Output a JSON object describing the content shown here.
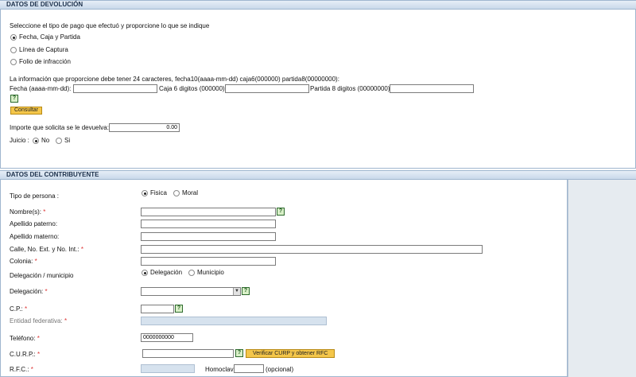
{
  "devolucion": {
    "header": "DATOS DE DEVOLUCIÓN",
    "instruction": "Seleccione el tipo de pago que efectuó y proporcione lo que se indique",
    "payment_options": [
      "Fecha, Caja y Partida",
      "Línea de Captura",
      "Folio de infracción"
    ],
    "selected_payment": "Fecha, Caja y Partida",
    "info_text": "La información que proporcione debe tener 24 caracteres, fecha10(aaaa-mm-dd) caja6(000000) partida8(00000000):",
    "fecha_label": "Fecha (aaaa-mm-dd):",
    "caja_label": "Caja 6 digitos (000000):",
    "partida_label": "Partida 8 digitos (00000000):",
    "help_glyph": "?",
    "consultar_label": "Consultar",
    "importe_label": "Importe que solicita se le devuelva:",
    "importe_value": "0.00",
    "juicio_label": "Juicio :",
    "juicio_options": [
      "No",
      "Si"
    ],
    "juicio_selected": "No"
  },
  "contribuyente": {
    "header": "DATOS DEL CONTRIBUYENTE",
    "tipo_persona_label": "Tipo de persona :",
    "tipo_persona_options": [
      "Fisica",
      "Moral"
    ],
    "tipo_persona_selected": "Fisica",
    "nombres_label": "Nombre(s):",
    "apellido_paterno_label": "Apellido paterno:",
    "apellido_materno_label": "Apellido materno:",
    "calle_label": "Calle, No. Ext. y No. Int.:",
    "colonia_label": "Colonia:",
    "deleg_mun_label": "Delegación / municipio",
    "deleg_mun_options": [
      "Delegación",
      "Municipio"
    ],
    "deleg_mun_selected": "Delegación",
    "delegacion_label": "Delegación:",
    "delegacion_value": "",
    "cp_label": "C.P.:",
    "entidad_label": "Entidad federativa:",
    "telefono_label": "Teléfono:",
    "telefono_value": "0000000000",
    "curp_label": "C.U.R.P.:",
    "verificar_label": "Verificar CURP y obtener RFC",
    "rfc_label": "R.F.C.:",
    "homoclave_label": "Homoclave:",
    "opcional_label": "(opcional)",
    "required_mark": "*"
  },
  "colors": {
    "header_bg": "#c9d9ea",
    "side_panel": "#e6ebf0",
    "button_orange": "#f4c64a",
    "required": "#dd3333"
  }
}
